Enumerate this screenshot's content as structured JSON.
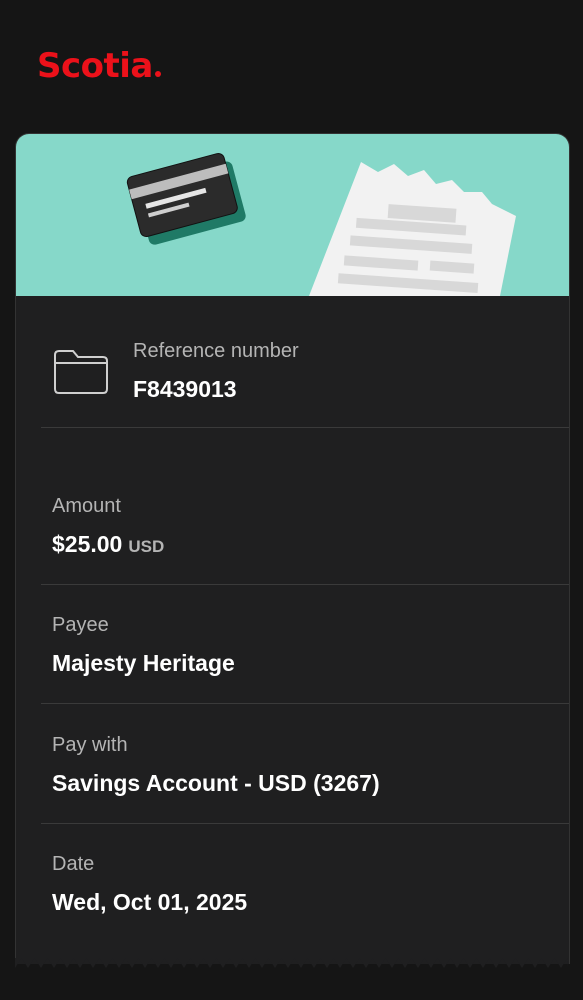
{
  "brand": {
    "logo_text": "Scotia"
  },
  "colors": {
    "brand_red": "#ec111a",
    "banner": "#86d8c9",
    "card_bg": "#1f1f20",
    "page_bg": "#151515"
  },
  "reference": {
    "label": "Reference number",
    "value": "F8439013"
  },
  "amount": {
    "label": "Amount",
    "value": "$25.00",
    "currency": "USD"
  },
  "payee": {
    "label": "Payee",
    "value": "Majesty Heritage"
  },
  "pay_with": {
    "label": "Pay with",
    "value": "Savings Account - USD (3267)"
  },
  "date": {
    "label": "Date",
    "value": "Wed, Oct 01, 2025"
  },
  "icons": [
    "credit-card-icon",
    "receipt-icon",
    "folder-icon"
  ]
}
